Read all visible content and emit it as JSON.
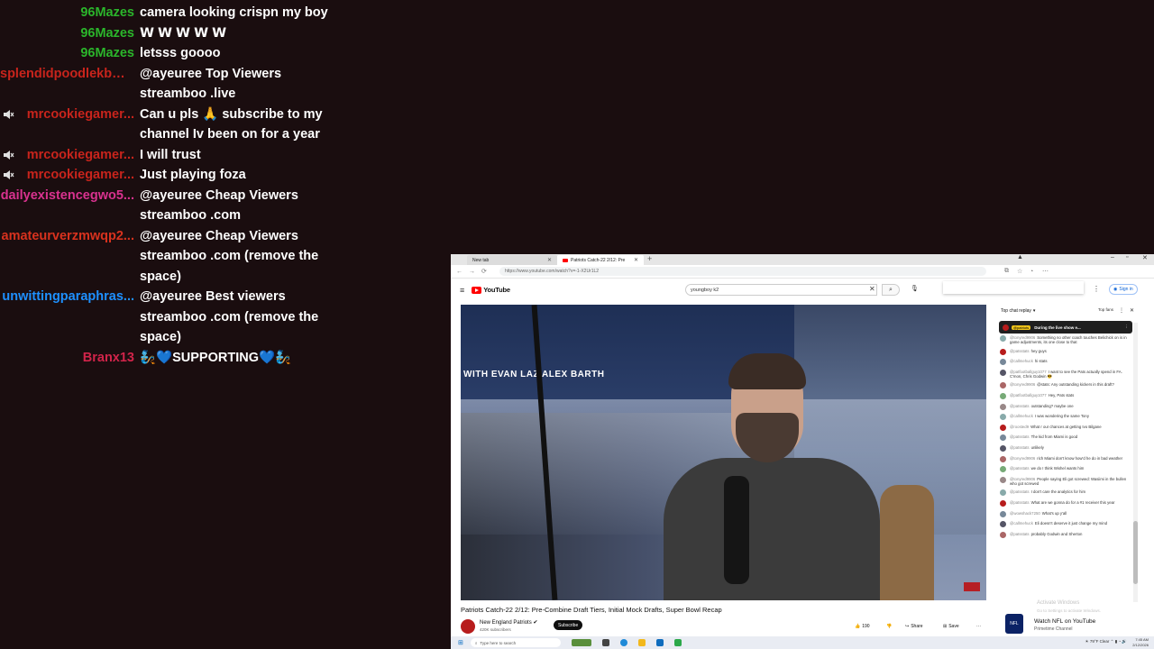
{
  "chat": [
    {
      "user": "96Mazes",
      "color": "#2bb52b",
      "text": "camera looking crispn my boy",
      "muted": false
    },
    {
      "user": "96Mazes",
      "color": "#2bb52b",
      "text": "𝗪 𝗪 𝗪 𝗪 𝗪",
      "muted": false
    },
    {
      "user": "96Mazes",
      "color": "#2bb52b",
      "text": "letsss goooo",
      "muted": false
    },
    {
      "user": "splendidpoodlekbm...",
      "color": "#c8241c",
      "text": "@ayeuree Top Viewers streamboo .live",
      "muted": false
    },
    {
      "user": "mrcookiegamer...",
      "color": "#c8241c",
      "text": "Can u pls 🙏 subscribe to my channel Iv been on for a year",
      "muted": true
    },
    {
      "user": "mrcookiegamer...",
      "color": "#c8241c",
      "text": "I will trust",
      "muted": true
    },
    {
      "user": "mrcookiegamer...",
      "color": "#c8241c",
      "text": "Just playing foza",
      "muted": true
    },
    {
      "user": "dailyexistencegwo5...",
      "color": "#d9328f",
      "text": "@ayeuree Cheap Viewers streamboo .com",
      "muted": false
    },
    {
      "user": "amateurverzmwqp2...",
      "color": "#d8321e",
      "text": "@ayeuree Cheap Viewers streamboo .com (remove the space)",
      "muted": false
    },
    {
      "user": "unwittingparaphras...",
      "color": "#1e90ff",
      "text": "@ayeuree Best viewers streamboo .com (remove the space)",
      "muted": false
    },
    {
      "user": "Branx13",
      "color": "#d1244a",
      "text": "🧞💙SUPPORTING💙🧞",
      "muted": false
    }
  ],
  "browser": {
    "tabs": [
      {
        "label": "New tab"
      },
      {
        "label": "Patriots Catch-22 2/12: Pre"
      }
    ],
    "url": "https://www.youtube.com/watch?v=-1-X2Ur1L2",
    "youtube": {
      "logo_text": "YouTube",
      "search_value": "youngboy k2",
      "sign_in": "Sign in",
      "video": {
        "banner": "WITH EVAN LAZ     ALEX BARTH",
        "title": "Patriots Catch-22 2/12: Pre-Combine Draft Tiers, Initial Mock Drafts, Super Bowl Recap",
        "channel": "New England Patriots",
        "subs": "420K subscribers",
        "subscribe": "Subscribe",
        "likes": "190",
        "share": "Share",
        "save": "Save",
        "more": "···"
      },
      "live_chat": {
        "mode": "Top chat replay",
        "top_fans": "Top fans",
        "pinned_tag": "@patriots",
        "pinned_text": "During the live show e...",
        "messages": [
          {
            "who": "@tonyred9906",
            "text": "Something no other coach touches Belichick on is in game adjustments, its one close to that"
          },
          {
            "who": "@patsstats",
            "text": "hey guys"
          },
          {
            "who": "@callmehuck",
            "text": "hi stats"
          },
          {
            "who": "@patfootballguy1077",
            "text": "I want to see the Pats actually spend in FA. C'mon, Chris Godwin 😎"
          },
          {
            "who": "@tonyred9906",
            "text": "@stats: Any outstanding kickers in this draft?"
          },
          {
            "who": "@patfootballguy1077",
            "text": "Hey, Pats stats"
          },
          {
            "who": "@patsstats",
            "text": "outstanding? maybe one"
          },
          {
            "who": "@callmehuck",
            "text": "I was wondering the same Tony"
          },
          {
            "who": "@roosted9",
            "text": "What r our chances at getting Ivo Bilgane"
          },
          {
            "who": "@patsstats",
            "text": "The kid from Miami is good"
          },
          {
            "who": "@patsstats",
            "text": "unlikely"
          },
          {
            "who": "@tonyred9906",
            "text": "rich Miami don't know how'd he do in bad weather"
          },
          {
            "who": "@patsstats",
            "text": "we do I think Wishel wants him"
          },
          {
            "who": "@tonyred9906",
            "text": "People saying Eli got screwed: Wasiimi in the bullen who got screwed"
          },
          {
            "who": "@patsstats",
            "text": "I don't care the analytics for him"
          },
          {
            "who": "@patsstats",
            "text": "What are we gonna do for a #1 receiver this year"
          },
          {
            "who": "@wowshack7250",
            "text": "What's up y'all"
          },
          {
            "who": "@callmehuck",
            "text": "Eli doesn't deserve it just change my mind"
          },
          {
            "who": "@patsstats",
            "text": "probably Godwin and Sherton"
          }
        ]
      },
      "recommend": {
        "title": "Watch NFL on YouTube",
        "sub": "Primetime Channel",
        "logo": "NFL"
      },
      "activate": {
        "line1": "Activate Windows",
        "line2": "Go to Settings to activate Windows."
      }
    },
    "taskbar": {
      "search_placeholder": "Type here to search",
      "weather": "79°F Clear",
      "time": "7:45 AM",
      "date": "2/12/2026"
    }
  }
}
